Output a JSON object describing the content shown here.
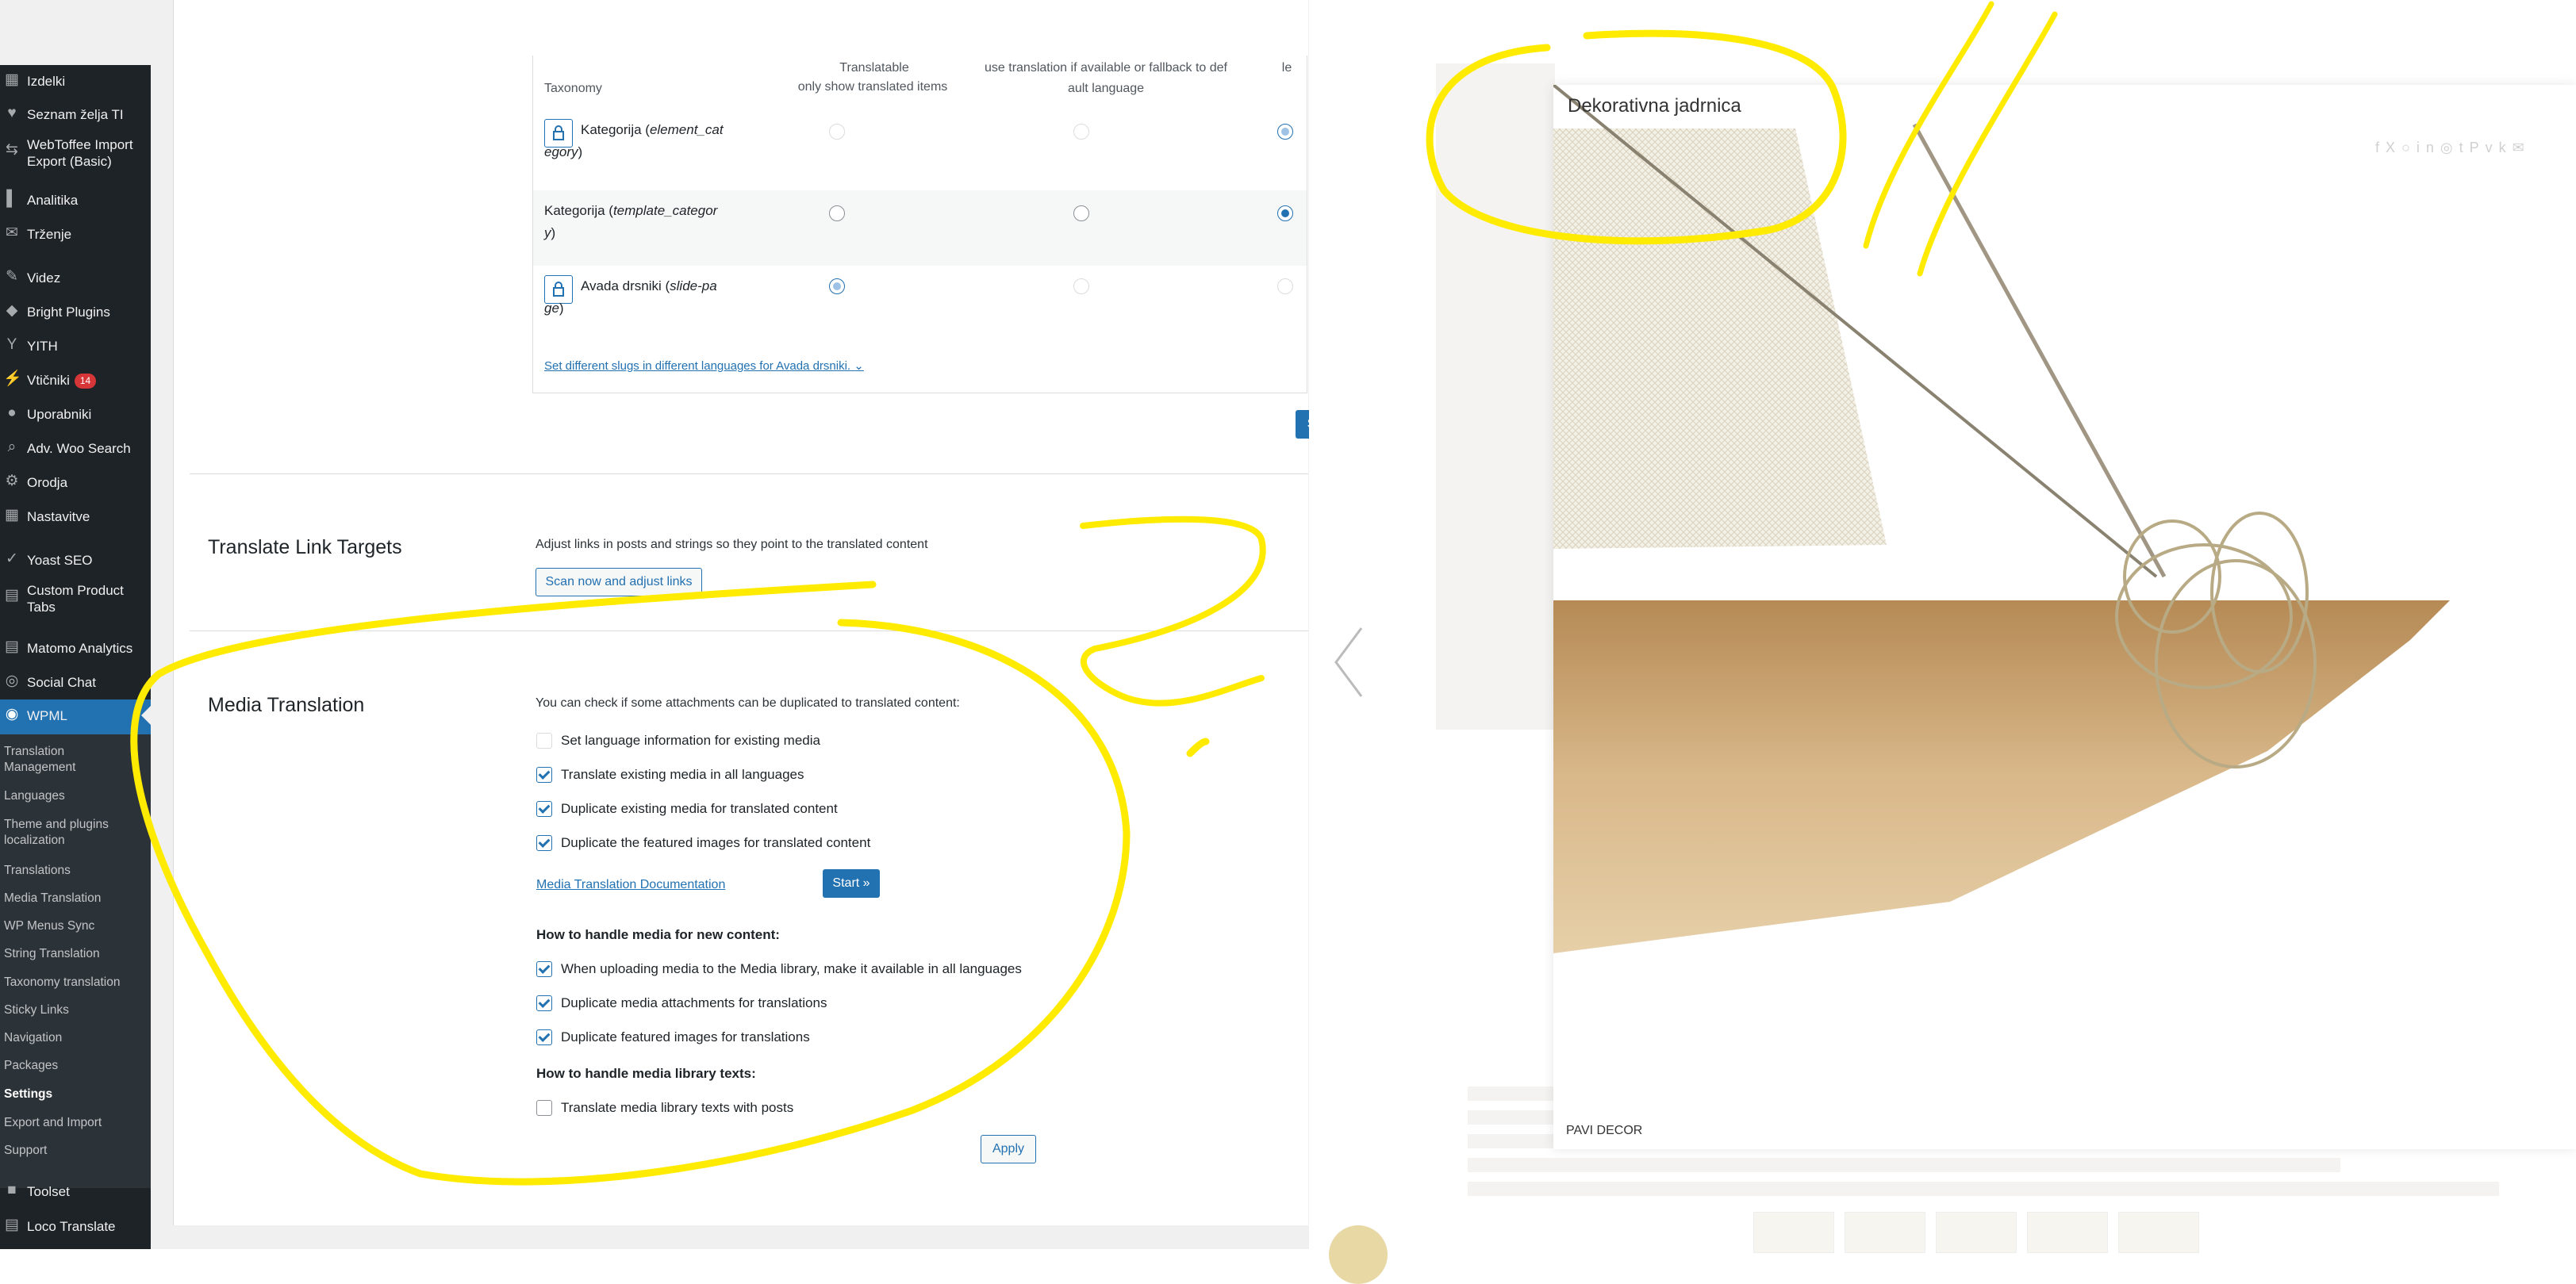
{
  "sidebar": {
    "items": [
      {
        "label": "Izdelki",
        "icon": "box-icon"
      },
      {
        "label": "Seznam želja TI",
        "icon": "heart-icon"
      },
      {
        "label": "WebToffee Import Export (Basic)",
        "icon": "import-export-icon"
      },
      {
        "label": "Analitika",
        "icon": "bar-chart-icon"
      },
      {
        "label": "Trženje",
        "icon": "megaphone-icon"
      },
      {
        "label": "Videz",
        "icon": "paintbrush-icon"
      },
      {
        "label": "Bright Plugins",
        "icon": "bright-plugins-icon"
      },
      {
        "label": "YITH",
        "icon": "yith-icon"
      },
      {
        "label": "Vtičniki",
        "icon": "plugin-icon",
        "badge": "14"
      },
      {
        "label": "Uporabniki",
        "icon": "user-icon"
      },
      {
        "label": "Adv. Woo Search",
        "icon": "search-icon"
      },
      {
        "label": "Orodja",
        "icon": "wrench-icon"
      },
      {
        "label": "Nastavitve",
        "icon": "settings-icon"
      },
      {
        "label": "Yoast SEO",
        "icon": "yoast-icon"
      },
      {
        "label": "Custom Product Tabs",
        "icon": "tabs-icon"
      },
      {
        "label": "Matomo Analytics",
        "icon": "analytics-icon"
      },
      {
        "label": "Social Chat",
        "icon": "chat-icon"
      },
      {
        "label": "WPML",
        "icon": "wpml-icon",
        "active": true
      },
      {
        "label": "Toolset",
        "icon": "toolset-icon"
      },
      {
        "label": "Loco Translate",
        "icon": "translate-icon"
      }
    ],
    "submenu": [
      "Translation Management",
      "Languages",
      "Theme and plugins localization",
      "Translations",
      "Media Translation",
      "WP Menus Sync",
      "String Translation",
      "Taxonomy translation",
      "Sticky Links",
      "Navigation",
      "Packages",
      "Settings",
      "Export and Import",
      "Support"
    ],
    "submenu_current": "Settings"
  },
  "taxonomy_table": {
    "header": {
      "taxonomy": "Taxonomy",
      "col1_top": "Translatable",
      "col1": "only show translated items",
      "col2_line1": "use translation if available or fallback to def",
      "col2_line2": "ault language",
      "col3": "le"
    },
    "rows": [
      {
        "name": "Kategorija",
        "slug_line1": "element_cat",
        "slug_line2": "egory",
        "locked": true,
        "selected": 3
      },
      {
        "name": "Kategorija",
        "slug_line1": "template_categor",
        "slug_line2": "y",
        "locked": false,
        "selected": 3
      },
      {
        "name": "Avada drsniki",
        "slug_line1": "slide-pa",
        "slug_line2": "ge",
        "locked": true,
        "selected": 1
      }
    ],
    "slugs_link": "Set different slugs in different languages for Avada drsniki.",
    "save_fragment": "S"
  },
  "link_targets": {
    "title": "Translate Link Targets",
    "description": "Adjust links in posts and strings so they point to the translated content",
    "button": "Scan now and adjust links"
  },
  "media_translation": {
    "title": "Media Translation",
    "intro": "You can check if some attachments can be duplicated to translated content:",
    "existing_options": [
      {
        "label": "Set language information for existing media",
        "checked": false
      },
      {
        "label": "Translate existing media in all languages",
        "checked": true
      },
      {
        "label": "Duplicate existing media for translated content",
        "checked": true
      },
      {
        "label": "Duplicate the featured images for translated content",
        "checked": true
      }
    ],
    "doc_link": "Media Translation Documentation",
    "start_button": "Start »",
    "new_content_heading": "How to handle media for new content:",
    "new_content_options": [
      {
        "label": "When uploading media to the Media library, make it available in all languages",
        "checked": true
      },
      {
        "label": "Duplicate media attachments for translations",
        "checked": true
      },
      {
        "label": "Duplicate featured images for translations",
        "checked": true
      }
    ],
    "library_heading": "How to handle media library texts:",
    "library_options": [
      {
        "label": "Translate media library texts with posts",
        "checked": false
      }
    ],
    "apply_button": "Apply"
  },
  "lightbox": {
    "title": "Dekorativna jadrnica",
    "brand": "PAVI DECOR",
    "share_icons": [
      "facebook-icon",
      "x-icon",
      "reddit-icon",
      "linkedin-icon",
      "whatsapp-icon",
      "tumblr-icon",
      "pinterest-icon",
      "vk-icon",
      "email-icon"
    ],
    "thumbnail_count": 5
  },
  "colors": {
    "wp_admin_bg": "#1d2327",
    "wp_submenu_bg": "#2c3338",
    "wp_accent": "#2271b1",
    "badge": "#d63638",
    "annotation_yellow": "#ffeb00"
  }
}
